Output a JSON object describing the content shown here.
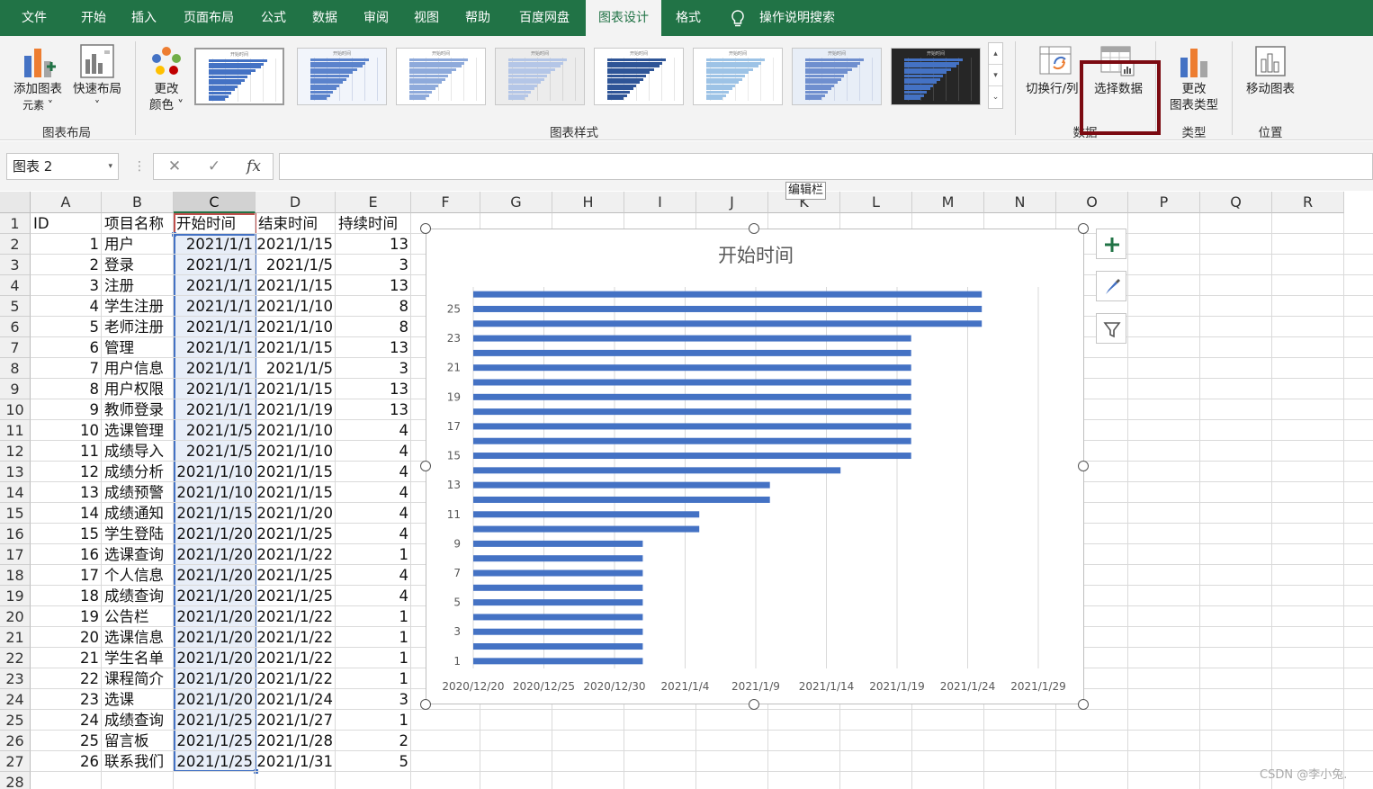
{
  "menubar": {
    "items": [
      "文件",
      "开始",
      "插入",
      "页面布局",
      "公式",
      "数据",
      "审阅",
      "视图",
      "帮助",
      "百度网盘",
      "图表设计",
      "格式"
    ],
    "active": "图表设计",
    "search_label": "操作说明搜索"
  },
  "ribbon": {
    "add_element": {
      "line1": "添加图表",
      "line2": "元素 ˅"
    },
    "quick_layout": {
      "line1": "快速布局",
      "line2": "˅"
    },
    "change_color": {
      "line1": "更改",
      "line2": "颜色 ˅"
    },
    "switch_row_col": "切换行/列",
    "select_data": "选择数据",
    "change_type": {
      "line1": "更改",
      "line2": "图表类型"
    },
    "move_chart": "移动图表",
    "groups": {
      "layout": "图表布局",
      "styles": "图表样式",
      "data": "数据",
      "type": "类型",
      "location": "位置"
    },
    "gallery_scroll": [
      "▴",
      "▾",
      "⌄"
    ],
    "thumb_title": "开始时间"
  },
  "tooltip": "编辑栏",
  "formula_bar": {
    "name_box": "图表 2",
    "name_arrow": "▾",
    "separator": "⋮",
    "cancel": "✕",
    "confirm": "✓",
    "fx": "fx",
    "value": ""
  },
  "columns": [
    "A",
    "B",
    "C",
    "D",
    "E",
    "F",
    "G",
    "H",
    "I",
    "J",
    "K",
    "L",
    "M",
    "N",
    "O",
    "P",
    "Q",
    "R"
  ],
  "rows": [
    "1",
    "2",
    "3",
    "4",
    "5",
    "6",
    "7",
    "8",
    "9",
    "10",
    "11",
    "12",
    "13",
    "14",
    "15",
    "16",
    "17",
    "18",
    "19",
    "20",
    "21",
    "22",
    "23",
    "24",
    "25",
    "26",
    "27",
    "28"
  ],
  "headers": [
    "ID",
    "项目名称",
    "开始时间",
    "结束时间",
    "持续时间"
  ],
  "table": [
    [
      "1",
      "用户",
      "2021/1/1",
      "2021/1/15",
      "13"
    ],
    [
      "2",
      "登录",
      "2021/1/1",
      "2021/1/5",
      "3"
    ],
    [
      "3",
      "注册",
      "2021/1/1",
      "2021/1/15",
      "13"
    ],
    [
      "4",
      "学生注册",
      "2021/1/1",
      "2021/1/10",
      "8"
    ],
    [
      "5",
      "老师注册",
      "2021/1/1",
      "2021/1/10",
      "8"
    ],
    [
      "6",
      "管理",
      "2021/1/1",
      "2021/1/15",
      "13"
    ],
    [
      "7",
      "用户信息",
      "2021/1/1",
      "2021/1/5",
      "3"
    ],
    [
      "8",
      "用户权限",
      "2021/1/1",
      "2021/1/15",
      "13"
    ],
    [
      "9",
      "教师登录",
      "2021/1/1",
      "2021/1/19",
      "13"
    ],
    [
      "10",
      "选课管理",
      "2021/1/5",
      "2021/1/10",
      "4"
    ],
    [
      "11",
      "成绩导入",
      "2021/1/5",
      "2021/1/10",
      "4"
    ],
    [
      "12",
      "成绩分析",
      "2021/1/10",
      "2021/1/15",
      "4"
    ],
    [
      "13",
      "成绩预警",
      "2021/1/10",
      "2021/1/15",
      "4"
    ],
    [
      "14",
      "成绩通知",
      "2021/1/15",
      "2021/1/20",
      "4"
    ],
    [
      "15",
      "学生登陆",
      "2021/1/20",
      "2021/1/25",
      "4"
    ],
    [
      "16",
      "选课查询",
      "2021/1/20",
      "2021/1/22",
      "1"
    ],
    [
      "17",
      "个人信息",
      "2021/1/20",
      "2021/1/25",
      "4"
    ],
    [
      "18",
      "成绩查询",
      "2021/1/20",
      "2021/1/25",
      "4"
    ],
    [
      "19",
      "公告栏",
      "2021/1/20",
      "2021/1/22",
      "1"
    ],
    [
      "20",
      "选课信息",
      "2021/1/20",
      "2021/1/22",
      "1"
    ],
    [
      "21",
      "学生名单",
      "2021/1/20",
      "2021/1/22",
      "1"
    ],
    [
      "22",
      "课程简介",
      "2021/1/20",
      "2021/1/22",
      "1"
    ],
    [
      "23",
      "选课",
      "2021/1/20",
      "2021/1/24",
      "3"
    ],
    [
      "24",
      "成绩查询",
      "2021/1/25",
      "2021/1/27",
      "1"
    ],
    [
      "25",
      "留言板",
      "2021/1/25",
      "2021/1/28",
      "2"
    ],
    [
      "26",
      "联系我们",
      "2021/1/25",
      "2021/1/31",
      "5"
    ]
  ],
  "chart_data": {
    "type": "bar",
    "orientation": "horizontal",
    "title": "开始时间",
    "categories": [
      "1",
      "2",
      "3",
      "4",
      "5",
      "6",
      "7",
      "8",
      "9",
      "10",
      "11",
      "12",
      "13",
      "14",
      "15",
      "16",
      "17",
      "18",
      "19",
      "20",
      "21",
      "22",
      "23",
      "24",
      "25",
      "26"
    ],
    "category_labels_shown": [
      "1",
      "3",
      "5",
      "7",
      "9",
      "11",
      "13",
      "15",
      "17",
      "19",
      "21",
      "23",
      "25"
    ],
    "values": [
      "2021/1/1",
      "2021/1/1",
      "2021/1/1",
      "2021/1/1",
      "2021/1/1",
      "2021/1/1",
      "2021/1/1",
      "2021/1/1",
      "2021/1/1",
      "2021/1/5",
      "2021/1/5",
      "2021/1/10",
      "2021/1/10",
      "2021/1/15",
      "2021/1/20",
      "2021/1/20",
      "2021/1/20",
      "2021/1/20",
      "2021/1/20",
      "2021/1/20",
      "2021/1/20",
      "2021/1/20",
      "2021/1/20",
      "2021/1/25",
      "2021/1/25",
      "2021/1/25"
    ],
    "xlim": [
      "2020/12/20",
      "2021/1/29"
    ],
    "x_ticks": [
      "2020/12/20",
      "2020/12/25",
      "2020/12/30",
      "2021/1/4",
      "2021/1/9",
      "2021/1/14",
      "2021/1/19",
      "2021/1/24",
      "2021/1/29"
    ],
    "grid": "vertical",
    "legend": "none",
    "bar_color": "#4472c4"
  },
  "chart_side_buttons": [
    "chart-elements",
    "chart-styles",
    "chart-filters"
  ],
  "colors": {
    "excel_green": "#217346",
    "accent_red": "#7b0a11",
    "bar_blue": "#4472c4"
  },
  "watermark": "CSDN @李小兔."
}
